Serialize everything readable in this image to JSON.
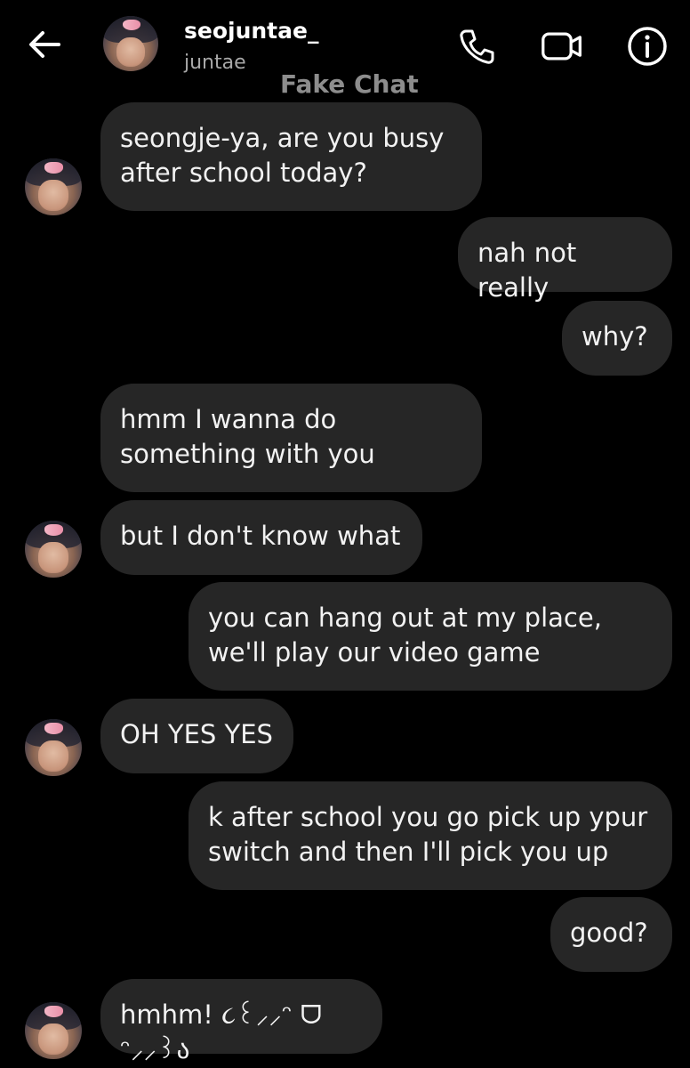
{
  "header": {
    "contact_username": "seojuntae_",
    "contact_name": "juntae",
    "watermark": "Fake Chat"
  },
  "icons": {
    "back": "arrow-left-icon",
    "call": "phone-icon",
    "video": "video-camera-icon",
    "info": "info-icon"
  },
  "messages": [
    {
      "from": "contact",
      "text": "seongje-ya, are you busy\nafter school today?"
    },
    {
      "from": "me",
      "text": "nah not really"
    },
    {
      "from": "me",
      "text": "why?"
    },
    {
      "from": "contact",
      "text": "hmm I wanna do\nsomething with you"
    },
    {
      "from": "contact",
      "text": "but I don't know what"
    },
    {
      "from": "me",
      "text": "you can hang out at my place,\nwe'll play our video game"
    },
    {
      "from": "contact",
      "text": "OH YES YES"
    },
    {
      "from": "me",
      "text": "k after school you go pick up ypur\nswitch and then I'll pick you up"
    },
    {
      "from": "me",
      "text": "good?"
    },
    {
      "from": "contact",
      "text": "hmhm! ૮꒰⸝⸝ᵔ ᗜ ᵔ⸝⸝꒱ა"
    }
  ],
  "colors": {
    "background": "#000000",
    "bubble": "#262626",
    "text": "#f2f2f2",
    "secondary_text": "#a8a8a8",
    "watermark": "#8d8d8d"
  }
}
